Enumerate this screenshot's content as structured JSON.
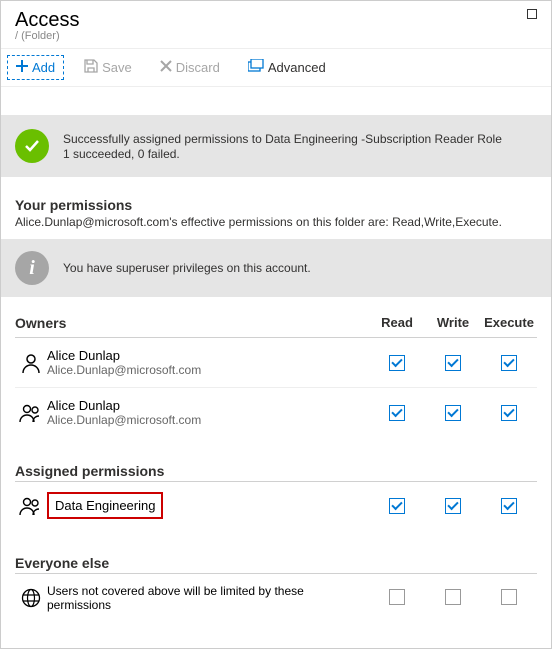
{
  "header": {
    "title": "Access",
    "breadcrumb": "/ (Folder)"
  },
  "toolbar": {
    "add": "Add",
    "save": "Save",
    "discard": "Discard",
    "advanced": "Advanced"
  },
  "success": {
    "line1": "Successfully assigned permissions to Data Engineering -Subscription Reader Role",
    "line2": "1 succeeded, 0 failed."
  },
  "permissions": {
    "title": "Your permissions",
    "desc": "Alice.Dunlap@microsoft.com's effective permissions on this folder are: Read,Write,Execute.",
    "info": "You have superuser privileges on this account."
  },
  "owners": {
    "title": "Owners",
    "cols": {
      "read": "Read",
      "write": "Write",
      "execute": "Execute"
    },
    "rows": [
      {
        "name": "Alice Dunlap",
        "email": "Alice.Dunlap@microsoft.com",
        "icon": "person",
        "read": true,
        "write": true,
        "execute": true
      },
      {
        "name": "Alice Dunlap",
        "email": "Alice.Dunlap@microsoft.com",
        "icon": "group",
        "read": true,
        "write": true,
        "execute": true
      }
    ]
  },
  "assigned": {
    "title": "Assigned permissions",
    "rows": [
      {
        "name": "Data Engineering",
        "icon": "group",
        "read": true,
        "write": true,
        "execute": true
      }
    ]
  },
  "everyone": {
    "title": "Everyone else",
    "rows": [
      {
        "desc": "Users not covered above will be limited by these permissions",
        "icon": "globe",
        "read": false,
        "write": false,
        "execute": false
      }
    ]
  }
}
